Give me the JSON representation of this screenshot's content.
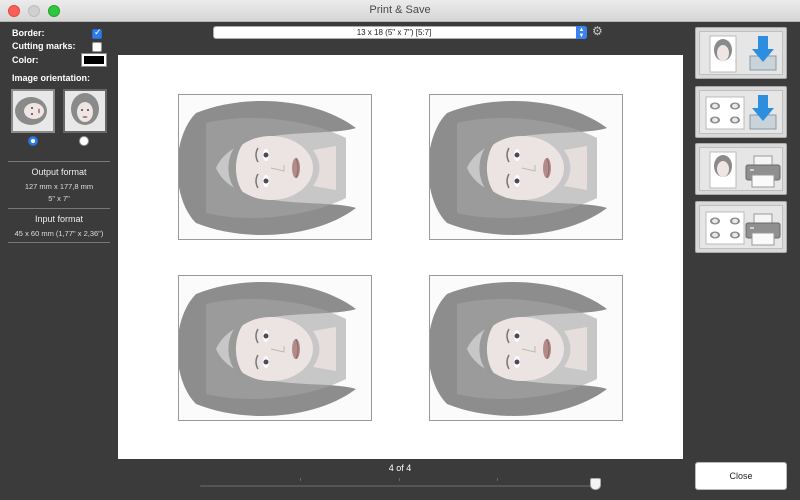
{
  "window": {
    "title": "Print & Save"
  },
  "options": {
    "border_label": "Border:",
    "border_checked": true,
    "cutting_marks_label": "Cutting marks:",
    "cutting_marks_checked": false,
    "color_label": "Color:",
    "color_value": "#000000",
    "orientation_label": "Image orientation:",
    "orientation_selected": "landscape"
  },
  "output_format": {
    "title": "Output format",
    "mm": "127 mm x 177,8 mm",
    "inches": "5\" x 7\""
  },
  "input_format": {
    "title": "Input format",
    "size": "45 x 60 mm (1,77\" x 2,36\")"
  },
  "format_select": {
    "value": "13 x 18 (5\" x 7\") [5:7]"
  },
  "preview": {
    "photo_count": 4
  },
  "pager": {
    "label": "4 of 4",
    "current": 4,
    "total": 4
  },
  "actions": [
    {
      "name": "save-single",
      "icon": "download-icon"
    },
    {
      "name": "save-sheet",
      "icon": "download-icon"
    },
    {
      "name": "print-single",
      "icon": "printer-icon"
    },
    {
      "name": "print-sheet",
      "icon": "printer-icon"
    }
  ],
  "close_button": {
    "label": "Close"
  },
  "colors": {
    "accent": "#2f7ce8",
    "background": "#3b3b3b",
    "download_blue": "#2d8ee0"
  }
}
